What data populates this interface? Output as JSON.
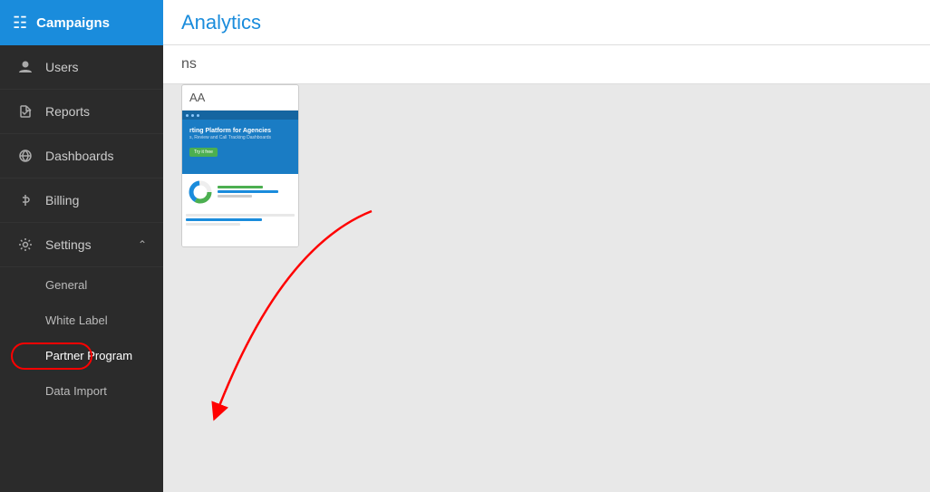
{
  "sidebar": {
    "header": {
      "label": "Campaigns",
      "icon": "grid"
    },
    "items": [
      {
        "id": "users",
        "label": "Users",
        "icon": "user"
      },
      {
        "id": "reports",
        "label": "Reports",
        "icon": "paper-plane"
      },
      {
        "id": "dashboards",
        "label": "Dashboards",
        "icon": "globe"
      },
      {
        "id": "billing",
        "label": "Billing",
        "icon": "dollar"
      }
    ],
    "settings": {
      "label": "Settings",
      "icon": "gear",
      "submenu": [
        {
          "id": "general",
          "label": "General"
        },
        {
          "id": "white-label",
          "label": "White Label"
        },
        {
          "id": "partner-program",
          "label": "Partner Program"
        },
        {
          "id": "data-import",
          "label": "Data Import"
        }
      ]
    }
  },
  "header": {
    "title": "Analytics"
  },
  "subheader": {
    "text": "ns"
  },
  "card": {
    "label": "AA",
    "blue_title": "rting Platform for Agencies",
    "blue_subtitle": "s, Review and Call Tracking Dashboards",
    "btn_label": "Try it free"
  },
  "colors": {
    "sidebar_bg": "#2b2b2b",
    "header_blue": "#1a8cdc",
    "accent_green": "#4caf50",
    "text_light": "#cccccc"
  }
}
